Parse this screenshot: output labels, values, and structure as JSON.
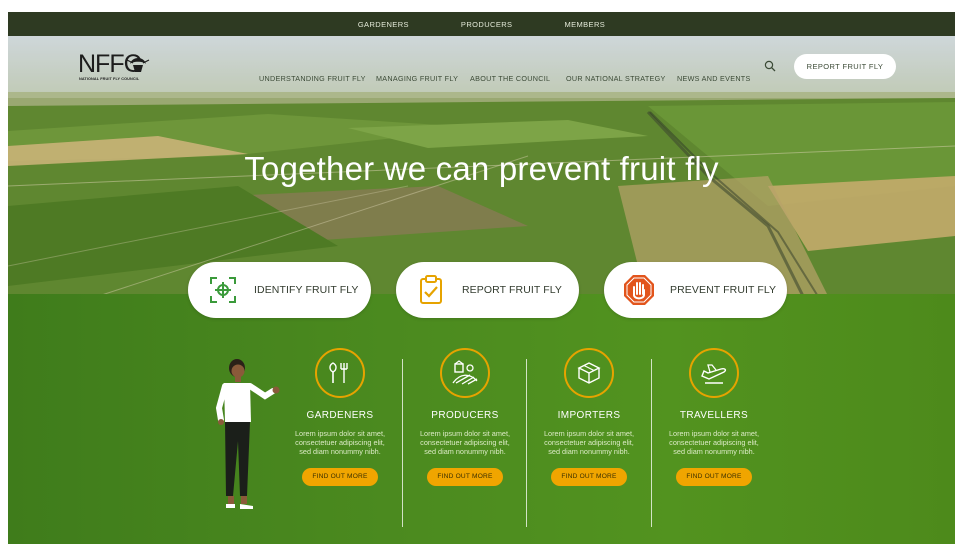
{
  "utility_nav": [
    "GARDENERS",
    "PRODUCERS",
    "MEMBERS"
  ],
  "logo": {
    "letters": "NFFC",
    "subtitle": "NATIONAL FRUIT FLY COUNCIL"
  },
  "main_nav": [
    "UNDERSTANDING FRUIT FLY",
    "MANAGING FRUIT FLY",
    "ABOUT THE COUNCIL",
    "OUR NATIONAL STRATEGY",
    "NEWS AND EVENTS"
  ],
  "report_button": "REPORT FRUIT FLY",
  "hero": {
    "title": "Together we can prevent fruit fly"
  },
  "quick_actions": [
    {
      "label": "IDENTIFY FRUIT FLY",
      "icon": "target-crosshair-icon"
    },
    {
      "label": "REPORT FRUIT FLY",
      "icon": "clipboard-check-icon"
    },
    {
      "label": "PREVENT FRUIT FLY",
      "icon": "stop-hand-icon"
    }
  ],
  "audiences": [
    {
      "title": "GARDENERS",
      "icon": "garden-tools-icon",
      "body": "Lorem ipsum dolor sit amet, consectetuer adipiscing elit, sed diam nonummy nibh.",
      "button": "FIND OUT MORE"
    },
    {
      "title": "PRODUCERS",
      "icon": "farm-field-icon",
      "body": "Lorem ipsum dolor sit amet, consectetuer adipiscing elit, sed diam nonummy nibh.",
      "button": "FIND OUT MORE"
    },
    {
      "title": "IMPORTERS",
      "icon": "package-box-icon",
      "body": "Lorem ipsum dolor sit amet, consectetuer adipiscing elit, sed diam nonummy nibh.",
      "button": "FIND OUT MORE"
    },
    {
      "title": "TRAVELLERS",
      "icon": "airplane-icon",
      "body": "Lorem ipsum dolor sit amet, consectetuer adipiscing elit, sed diam nonummy nibh.",
      "button": "FIND OUT MORE"
    }
  ],
  "colors": {
    "topbar": "#2e3a22",
    "panel_green": "#4b8a1f",
    "accent_orange": "#f0a500",
    "icon_red": "#e2541c"
  }
}
